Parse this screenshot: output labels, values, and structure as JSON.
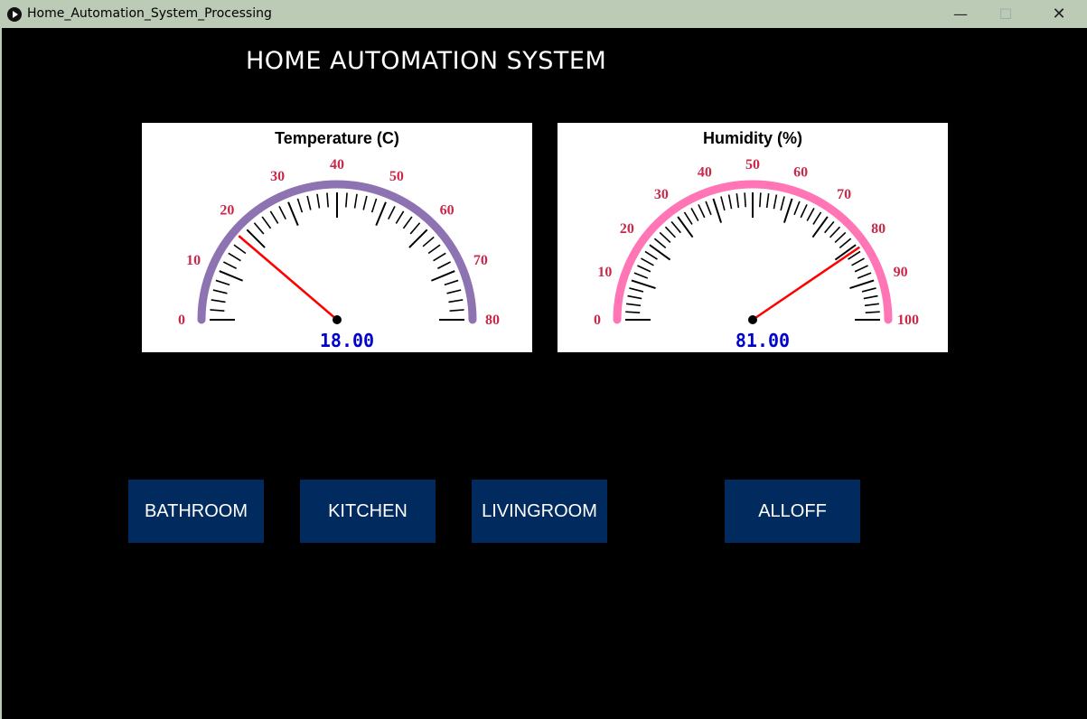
{
  "window": {
    "title": "Home_Automation_System_Processing",
    "icon": "play-circle-icon",
    "controls": {
      "minimize": "—",
      "maximize": "☐",
      "close": "✕"
    }
  },
  "heading": "HOME AUTOMATION SYSTEM",
  "gauges": [
    {
      "id": "temperature",
      "title": "Temperature (C)",
      "min": 0,
      "max": 80,
      "major_step": 10,
      "minor_per_major": 5,
      "value": 18,
      "value_text": "18.00",
      "arc_color": "#8e73b3",
      "needle_color": "#ff0000",
      "scale_label_color": "#c8284a",
      "value_text_color": "#0000cc"
    },
    {
      "id": "humidity",
      "title": "Humidity (%)",
      "min": 0,
      "max": 100,
      "major_step": 10,
      "minor_per_major": 5,
      "value": 81,
      "value_text": "81.00",
      "arc_color": "#ff75b6",
      "needle_color": "#ff0000",
      "scale_label_color": "#c8284a",
      "value_text_color": "#0000cc"
    }
  ],
  "buttons": {
    "bathroom": "BATHROOM",
    "kitchen": "KITCHEN",
    "livingroom": "LIVINGROOM",
    "alloff": "ALLOFF"
  },
  "colors": {
    "background": "#000000",
    "titlebar": "#bccbb6",
    "button_bg": "#012b5e",
    "button_text": "#ffffff"
  }
}
